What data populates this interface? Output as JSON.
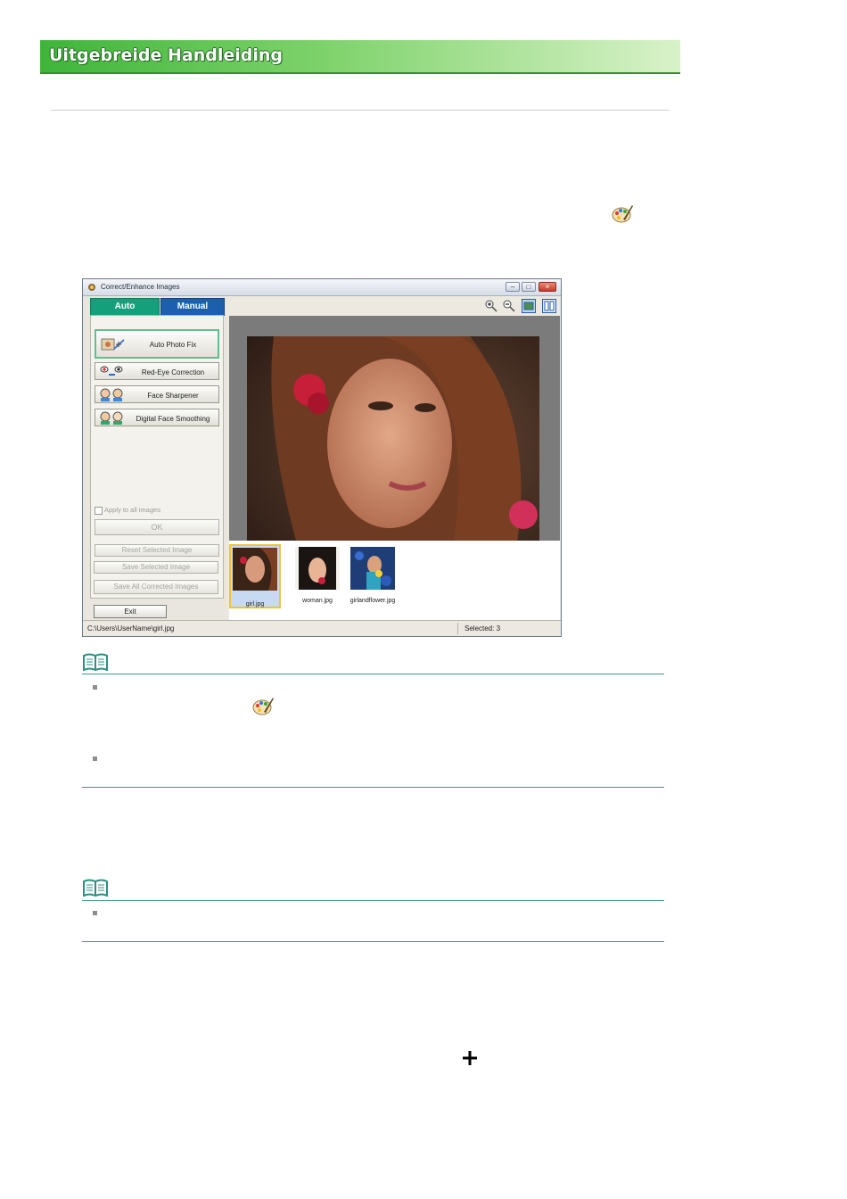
{
  "header": {
    "title": "Uitgebreide Handleiding"
  },
  "icons": {
    "palette": "palette-icon",
    "note": "book-note-icon",
    "plus": "plus-icon"
  },
  "window": {
    "title": "Correct/Enhance Images",
    "tabs": {
      "auto": "Auto",
      "manual": "Manual"
    },
    "functions": [
      {
        "label": "Auto Photo Fix",
        "icon": "auto-photo-fix-icon",
        "selected": true
      },
      {
        "label": "Red-Eye Correction",
        "icon": "red-eye-icon",
        "selected": false
      },
      {
        "label": "Face Sharpener",
        "icon": "face-sharpener-icon",
        "selected": false
      },
      {
        "label": "Digital Face Smoothing",
        "icon": "face-smoothing-icon",
        "selected": false
      }
    ],
    "apply_all": "Apply to all images",
    "ok": "OK",
    "reset": "Reset Selected Image",
    "save_selected": "Save Selected Image",
    "save_all": "Save All Corrected Images",
    "exit": "Exit",
    "thumbnails": [
      "girl.jpg",
      "woman.jpg",
      "girlandflower.jpg"
    ],
    "status_path": "C:\\Users\\UserName\\girl.jpg",
    "status_selected": "Selected: 3"
  },
  "colors": {
    "banner_green": "#3fb43a",
    "tab_auto": "#14a07a",
    "tab_manual": "#1b5fad",
    "note_line": "#3a9b8a"
  }
}
